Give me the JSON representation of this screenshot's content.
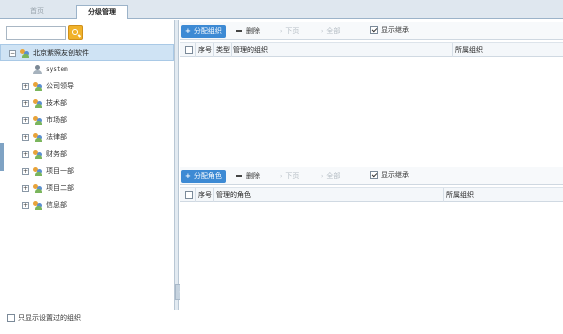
{
  "tabs": {
    "home": "首页",
    "current": "分级管理"
  },
  "tree": {
    "search_value": "",
    "root": "北京紫照友创软件",
    "user": "system",
    "departments": [
      "公司领导",
      "技术部",
      "市场部",
      "法律部",
      "财务部",
      "项目一部",
      "项目二部",
      "信息部"
    ]
  },
  "footer": {
    "label": "只显示设置过的组织",
    "checked": false
  },
  "org_panel": {
    "assign_label": "分配组织",
    "delete_label": "删除",
    "down_label": "下页",
    "all_label": "全部",
    "show_inherit_label": "显示继承",
    "show_inherit_checked": true,
    "columns": [
      "序号",
      "类型",
      "管理的组织",
      "所属组织"
    ]
  },
  "role_panel": {
    "assign_label": "分配角色",
    "delete_label": "删除",
    "down_label": "下页",
    "all_label": "全部",
    "show_inherit_label": "显示继承",
    "show_inherit_checked": true,
    "columns": [
      "序号",
      "管理的角色",
      "所属组织"
    ]
  },
  "colors": {
    "accent": "#3d8ad4",
    "search_button": "#f0b22a",
    "selected_row": "#cfe3f4"
  },
  "icons": {
    "search": "search-icon",
    "org": "org-group-icon",
    "user": "user-icon",
    "add": "plus-icon",
    "remove": "minus-icon"
  }
}
